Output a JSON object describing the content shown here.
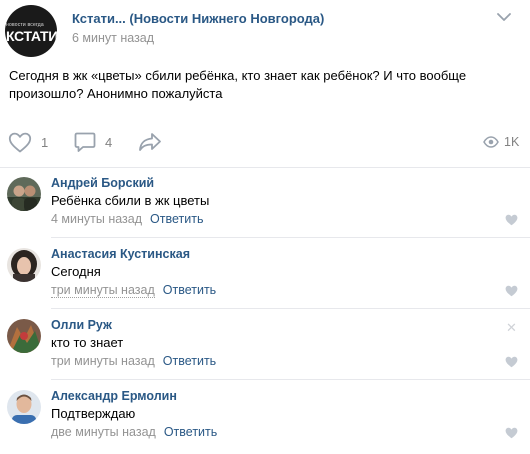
{
  "post": {
    "group_name": "Кстати... (Новости Нижнего Новгорода)",
    "time": "6 минут назад",
    "logo": {
      "small_text": "новости всегда",
      "big_text": "КСТАТИ."
    },
    "text": "Сегодня в жк «цветы» сбили ребёнка, кто знает как ребёнок? И что вообще произошло? Анонимно пожалуйста",
    "likes": "1",
    "comments_count": "4",
    "views": "1K"
  },
  "comments": [
    {
      "author": "Андрей Борский",
      "text": "Ребёнка сбили в жк цветы",
      "date": "4 минуты назад",
      "reply": "Ответить"
    },
    {
      "author": "Анастасия Кустинская",
      "text": "Сегодня",
      "date": "три минуты назад",
      "reply": "Ответить"
    },
    {
      "author": "Олли Руж",
      "text": "кто то знает",
      "date": "три минуты назад",
      "reply": "Ответить"
    },
    {
      "author": "Александр Ермолин",
      "text": "Подтверждаю",
      "date": "две минуты назад",
      "reply": "Ответить"
    }
  ],
  "colors": {
    "link": "#2a5885",
    "meta": "#939393",
    "icon": "#99a2ad",
    "divider": "#e7e8ec"
  }
}
